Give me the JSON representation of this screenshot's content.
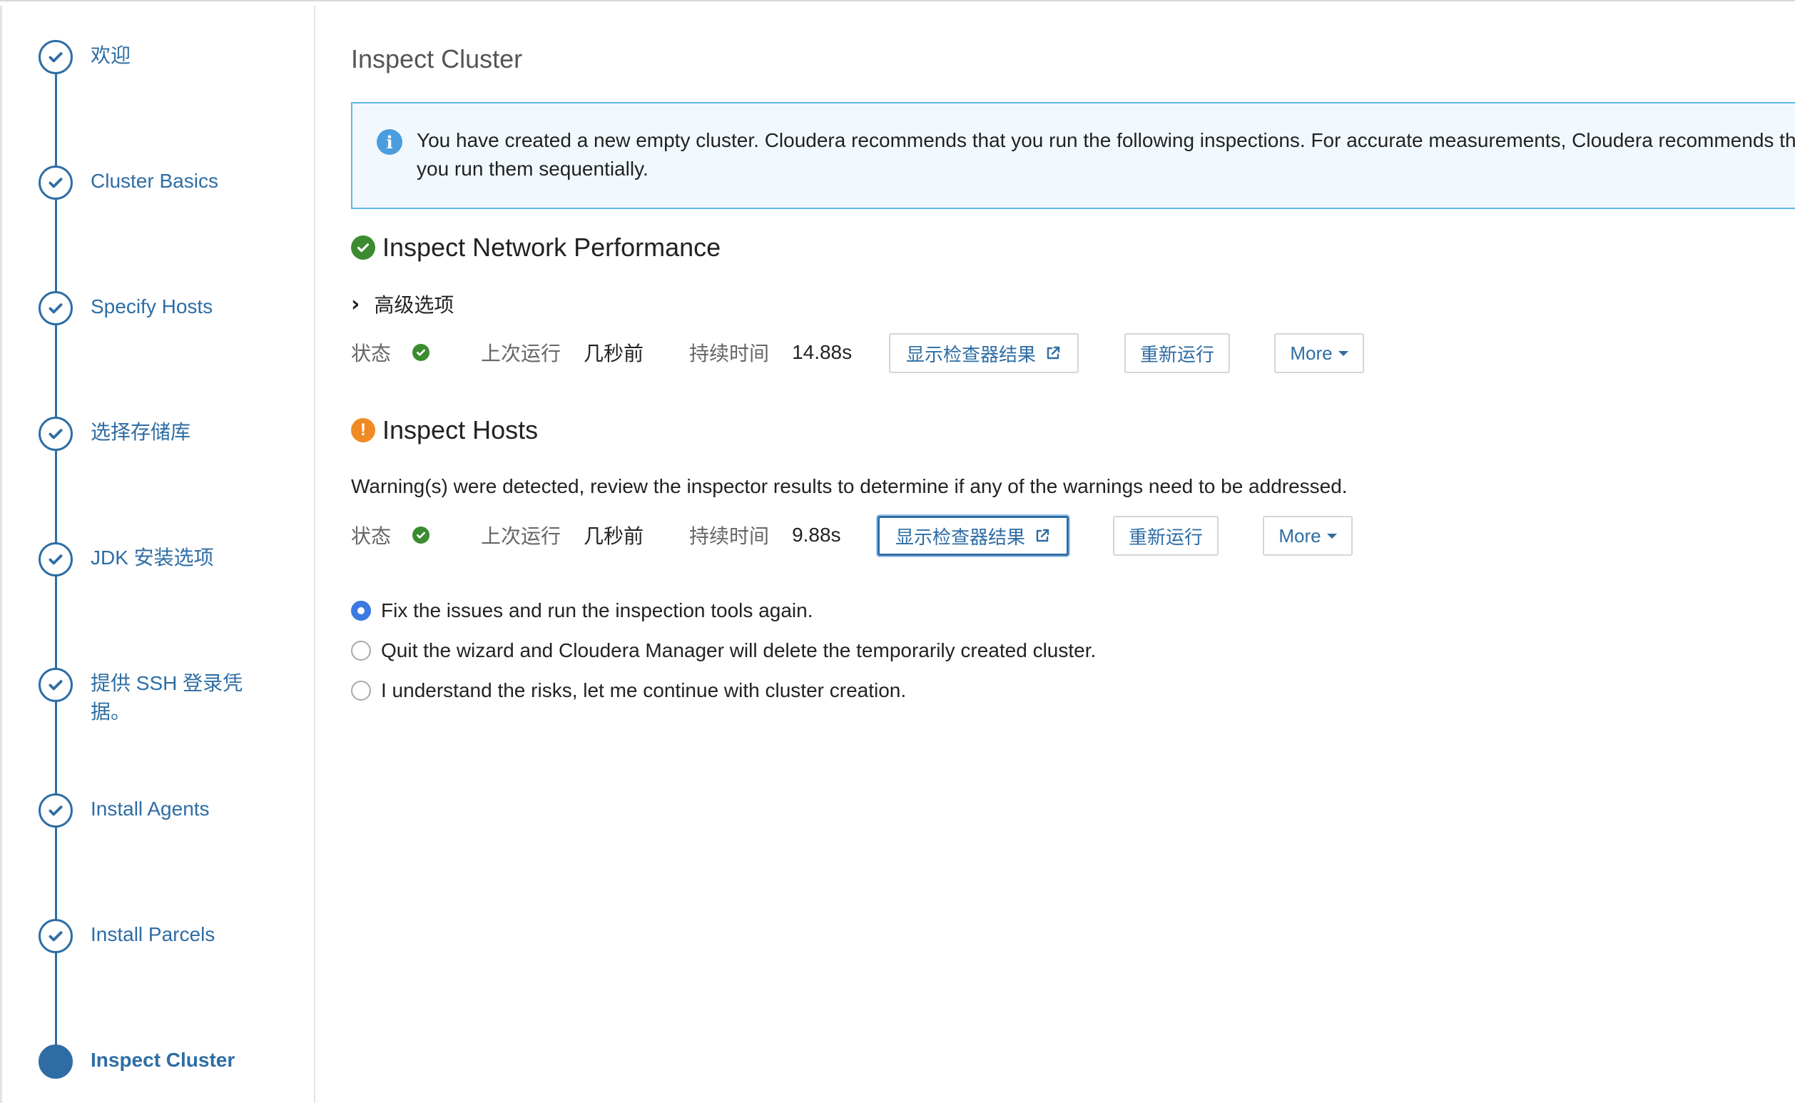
{
  "sidebar": {
    "steps": [
      {
        "label": "欢迎"
      },
      {
        "label": "Cluster Basics"
      },
      {
        "label": "Specify Hosts"
      },
      {
        "label": "选择存储库"
      },
      {
        "label": "JDK 安装选项"
      },
      {
        "label": "提供 SSH 登录凭据。"
      },
      {
        "label": "Install Agents"
      },
      {
        "label": "Install Parcels"
      },
      {
        "label": "Inspect Cluster"
      }
    ],
    "active_step": "Inspect Cluster"
  },
  "main": {
    "title": "Inspect Cluster",
    "alert_text": "You have created a new empty cluster. Cloudera recommends that you run the following inspections. For accurate measurements, Cloudera recommends that you run them sequentially.",
    "network": {
      "title": "Inspect Network Performance",
      "advanced_label": "高级选项",
      "status_label": "状态",
      "last_run_label": "上次运行",
      "last_run_value": "几秒前",
      "duration_label": "持续时间",
      "duration_value": "14.88s",
      "show_results_label": "显示检查器结果",
      "rerun_label": "重新运行",
      "more_label": "More"
    },
    "hosts": {
      "title": "Inspect Hosts",
      "warning_text": "Warning(s) were detected, review the inspector results to determine if any of the warnings need to be addressed.",
      "status_label": "状态",
      "last_run_label": "上次运行",
      "last_run_value": "几秒前",
      "duration_label": "持续时间",
      "duration_value": "9.88s",
      "show_results_label": "显示检查器结果",
      "rerun_label": "重新运行",
      "more_label": "More"
    },
    "options": [
      {
        "label": "Fix the issues and run the inspection tools again.",
        "selected": true
      },
      {
        "label": "Quit the wizard and Cloudera Manager will delete the temporarily created cluster.",
        "selected": false
      },
      {
        "label": "I understand the risks, let me continue with cluster creation.",
        "selected": false
      }
    ]
  },
  "colors": {
    "accent": "#2e6da4",
    "success": "#3a8c2f",
    "warning": "#f08a24",
    "info_border": "#5bb6e6"
  }
}
